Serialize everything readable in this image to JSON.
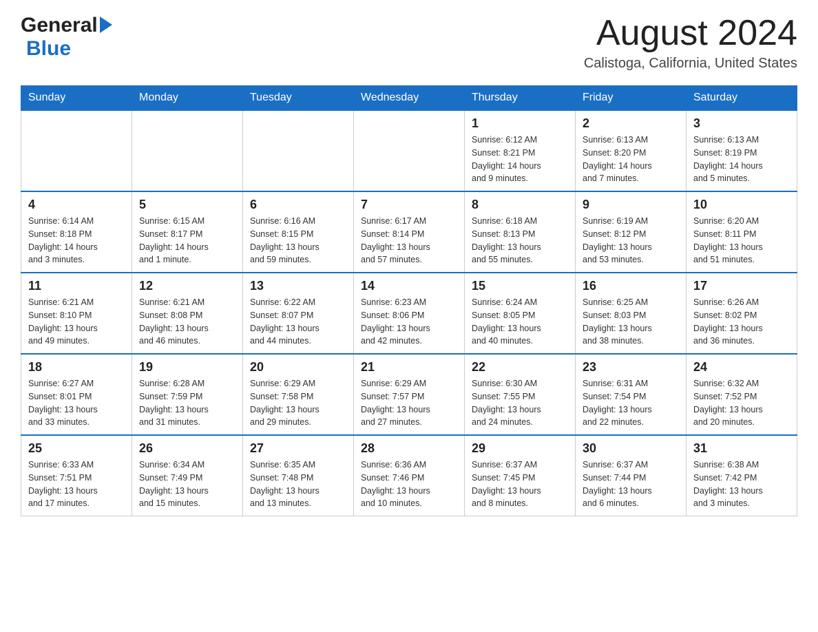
{
  "header": {
    "logo_general": "General",
    "logo_blue": "Blue",
    "month_title": "August 2024",
    "location": "Calistoga, California, United States"
  },
  "weekdays": [
    "Sunday",
    "Monday",
    "Tuesday",
    "Wednesday",
    "Thursday",
    "Friday",
    "Saturday"
  ],
  "weeks": [
    {
      "days": [
        {
          "number": "",
          "info": ""
        },
        {
          "number": "",
          "info": ""
        },
        {
          "number": "",
          "info": ""
        },
        {
          "number": "",
          "info": ""
        },
        {
          "number": "1",
          "info": "Sunrise: 6:12 AM\nSunset: 8:21 PM\nDaylight: 14 hours\nand 9 minutes."
        },
        {
          "number": "2",
          "info": "Sunrise: 6:13 AM\nSunset: 8:20 PM\nDaylight: 14 hours\nand 7 minutes."
        },
        {
          "number": "3",
          "info": "Sunrise: 6:13 AM\nSunset: 8:19 PM\nDaylight: 14 hours\nand 5 minutes."
        }
      ]
    },
    {
      "days": [
        {
          "number": "4",
          "info": "Sunrise: 6:14 AM\nSunset: 8:18 PM\nDaylight: 14 hours\nand 3 minutes."
        },
        {
          "number": "5",
          "info": "Sunrise: 6:15 AM\nSunset: 8:17 PM\nDaylight: 14 hours\nand 1 minute."
        },
        {
          "number": "6",
          "info": "Sunrise: 6:16 AM\nSunset: 8:15 PM\nDaylight: 13 hours\nand 59 minutes."
        },
        {
          "number": "7",
          "info": "Sunrise: 6:17 AM\nSunset: 8:14 PM\nDaylight: 13 hours\nand 57 minutes."
        },
        {
          "number": "8",
          "info": "Sunrise: 6:18 AM\nSunset: 8:13 PM\nDaylight: 13 hours\nand 55 minutes."
        },
        {
          "number": "9",
          "info": "Sunrise: 6:19 AM\nSunset: 8:12 PM\nDaylight: 13 hours\nand 53 minutes."
        },
        {
          "number": "10",
          "info": "Sunrise: 6:20 AM\nSunset: 8:11 PM\nDaylight: 13 hours\nand 51 minutes."
        }
      ]
    },
    {
      "days": [
        {
          "number": "11",
          "info": "Sunrise: 6:21 AM\nSunset: 8:10 PM\nDaylight: 13 hours\nand 49 minutes."
        },
        {
          "number": "12",
          "info": "Sunrise: 6:21 AM\nSunset: 8:08 PM\nDaylight: 13 hours\nand 46 minutes."
        },
        {
          "number": "13",
          "info": "Sunrise: 6:22 AM\nSunset: 8:07 PM\nDaylight: 13 hours\nand 44 minutes."
        },
        {
          "number": "14",
          "info": "Sunrise: 6:23 AM\nSunset: 8:06 PM\nDaylight: 13 hours\nand 42 minutes."
        },
        {
          "number": "15",
          "info": "Sunrise: 6:24 AM\nSunset: 8:05 PM\nDaylight: 13 hours\nand 40 minutes."
        },
        {
          "number": "16",
          "info": "Sunrise: 6:25 AM\nSunset: 8:03 PM\nDaylight: 13 hours\nand 38 minutes."
        },
        {
          "number": "17",
          "info": "Sunrise: 6:26 AM\nSunset: 8:02 PM\nDaylight: 13 hours\nand 36 minutes."
        }
      ]
    },
    {
      "days": [
        {
          "number": "18",
          "info": "Sunrise: 6:27 AM\nSunset: 8:01 PM\nDaylight: 13 hours\nand 33 minutes."
        },
        {
          "number": "19",
          "info": "Sunrise: 6:28 AM\nSunset: 7:59 PM\nDaylight: 13 hours\nand 31 minutes."
        },
        {
          "number": "20",
          "info": "Sunrise: 6:29 AM\nSunset: 7:58 PM\nDaylight: 13 hours\nand 29 minutes."
        },
        {
          "number": "21",
          "info": "Sunrise: 6:29 AM\nSunset: 7:57 PM\nDaylight: 13 hours\nand 27 minutes."
        },
        {
          "number": "22",
          "info": "Sunrise: 6:30 AM\nSunset: 7:55 PM\nDaylight: 13 hours\nand 24 minutes."
        },
        {
          "number": "23",
          "info": "Sunrise: 6:31 AM\nSunset: 7:54 PM\nDaylight: 13 hours\nand 22 minutes."
        },
        {
          "number": "24",
          "info": "Sunrise: 6:32 AM\nSunset: 7:52 PM\nDaylight: 13 hours\nand 20 minutes."
        }
      ]
    },
    {
      "days": [
        {
          "number": "25",
          "info": "Sunrise: 6:33 AM\nSunset: 7:51 PM\nDaylight: 13 hours\nand 17 minutes."
        },
        {
          "number": "26",
          "info": "Sunrise: 6:34 AM\nSunset: 7:49 PM\nDaylight: 13 hours\nand 15 minutes."
        },
        {
          "number": "27",
          "info": "Sunrise: 6:35 AM\nSunset: 7:48 PM\nDaylight: 13 hours\nand 13 minutes."
        },
        {
          "number": "28",
          "info": "Sunrise: 6:36 AM\nSunset: 7:46 PM\nDaylight: 13 hours\nand 10 minutes."
        },
        {
          "number": "29",
          "info": "Sunrise: 6:37 AM\nSunset: 7:45 PM\nDaylight: 13 hours\nand 8 minutes."
        },
        {
          "number": "30",
          "info": "Sunrise: 6:37 AM\nSunset: 7:44 PM\nDaylight: 13 hours\nand 6 minutes."
        },
        {
          "number": "31",
          "info": "Sunrise: 6:38 AM\nSunset: 7:42 PM\nDaylight: 13 hours\nand 3 minutes."
        }
      ]
    }
  ]
}
